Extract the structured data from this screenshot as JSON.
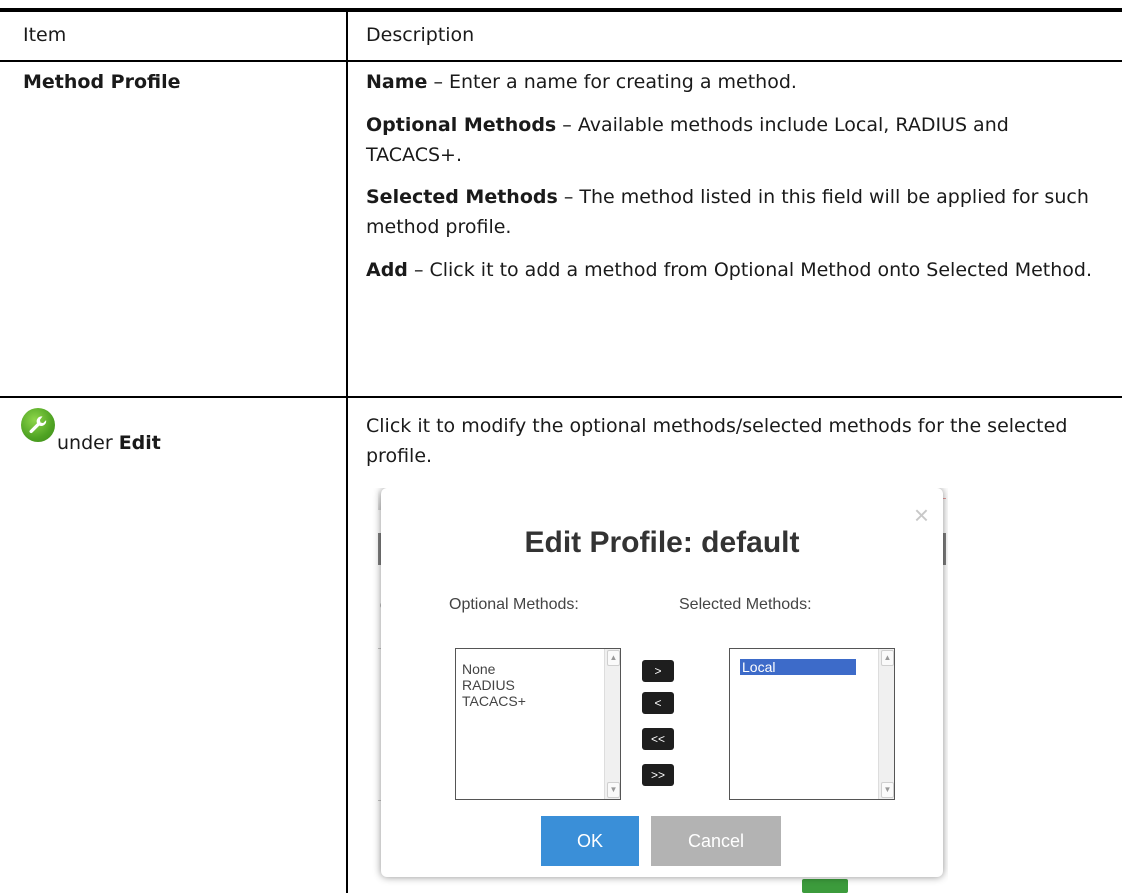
{
  "table": {
    "header_item": "Item",
    "header_description": "Description"
  },
  "row1": {
    "item": "Method Profile",
    "entries": [
      {
        "term": "Name",
        "text": " – Enter a name for creating a method."
      },
      {
        "term": "Optional Methods",
        "text": " – Available methods include Local, RADIUS and TACACS+."
      },
      {
        "term": "Selected Methods",
        "text": " – The method listed in this field will be applied for such method profile."
      },
      {
        "term": "Add",
        "text": " – Click it to add a method from Optional Method onto Selected Method."
      }
    ]
  },
  "row2": {
    "icon": "wrench-icon",
    "item_prefix": "under ",
    "item_bold": "Edit",
    "description": "Click it to modify the optional methods/selected methods for the selected profile."
  },
  "dialog": {
    "title": "Edit Profile: default",
    "close": "×",
    "optional_label": "Optional Methods:",
    "selected_label": "Selected Methods:",
    "optional_items": [
      "None",
      "RADIUS",
      "TACACS+"
    ],
    "selected_items": [
      "Local"
    ],
    "move_buttons": [
      ">",
      "<",
      "<<",
      ">>"
    ],
    "ok_label": "OK",
    "cancel_label": "Cancel",
    "colors": {
      "ok": "#3a8fd8",
      "cancel": "#b3b3b3",
      "selected_highlight": "#3d6bc9"
    }
  }
}
